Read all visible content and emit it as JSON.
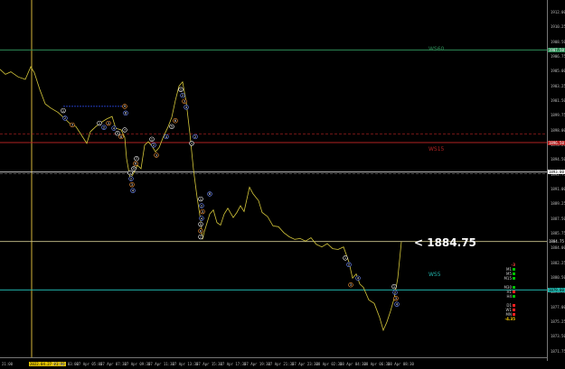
{
  "current_price_label": "< 1884.75",
  "levels": {
    "ws60": {
      "label": "WS60",
      "color": "#2e8b57",
      "price": 1907.5
    },
    "ws15": {
      "label": "WS15",
      "color": "#b22222",
      "price": 1896.5
    },
    "ws15_upper": {
      "price": 1897.5
    },
    "ws5": {
      "label": "WS5",
      "color": "#20b2aa",
      "price": 1879.0
    },
    "current": {
      "price": 1884.75
    },
    "white": {
      "price": 1893.0
    }
  },
  "price_ticks": [
    "1912.00",
    "1910.25",
    "1908.50",
    "1906.75",
    "1905.00",
    "1903.25",
    "1901.50",
    "1899.75",
    "1898.00",
    "1896.25",
    "1894.50",
    "1892.75",
    "1891.00",
    "1889.25",
    "1887.50",
    "1885.75",
    "1884.00",
    "1882.25",
    "1880.50",
    "1878.75",
    "1877.00",
    "1875.25",
    "1873.50",
    "1871.75"
  ],
  "axis_flags": [
    {
      "text": "1907.50",
      "bg": "#2e8b57",
      "fg": "#fff",
      "price": 1907.5
    },
    {
      "text": "1896.50",
      "bg": "#b22222",
      "fg": "#fff",
      "price": 1896.5
    },
    {
      "text": "1893.00",
      "bg": "#ffffff",
      "fg": "#000",
      "price": 1893.0
    },
    {
      "text": "1884.75",
      "bg": "#000",
      "fg": "#fff",
      "price": 1884.75
    },
    {
      "text": "1879.00",
      "bg": "#20b2aa",
      "fg": "#000",
      "price": 1879.0
    }
  ],
  "time_labels": [
    "27 Apr 03:00",
    "27 Apr 05:00",
    "27 Apr 07:30",
    "27 Apr 09:30",
    "27 Apr 11:30",
    "27 Apr 13:30",
    "27 Apr 15:30",
    "27 Apr 17:30",
    "27 Apr 19:30",
    "27 Apr 21:30",
    "27 Apr 23:30",
    "28 Apr 02:30",
    "28 Apr 04:30",
    "28 Apr 06:30",
    "28 Apr 08:30"
  ],
  "time_highlight": "2022.04.27 01:00",
  "left_time": "21:00",
  "timeframes": [
    {
      "label": "",
      "color": "#ff4040",
      "value": "-3"
    },
    {
      "label": "M1",
      "color": "#00c000"
    },
    {
      "label": "M5",
      "color": "#00c000"
    },
    {
      "label": "M15",
      "color": "#00c000"
    },
    {
      "label": "",
      "color": ""
    },
    {
      "label": "M30",
      "color": "#00c000"
    },
    {
      "label": "H1",
      "color": "#ff2020"
    },
    {
      "label": "H4",
      "color": "#00c000"
    },
    {
      "label": "",
      "color": ""
    },
    {
      "label": "D1",
      "color": "#ff2020"
    },
    {
      "label": "W1",
      "color": "#ff2020"
    },
    {
      "label": "MN",
      "color": "#ff2020"
    },
    {
      "label": "",
      "color": "#ffd000",
      "value": "-4.35"
    }
  ],
  "price_series": [
    [
      0,
      1905.2
    ],
    [
      6,
      1904.6
    ],
    [
      12,
      1904.9
    ],
    [
      20,
      1904.3
    ],
    [
      28,
      1904.0
    ],
    [
      34,
      1905.5
    ],
    [
      38,
      1904.8
    ],
    [
      44,
      1902.8
    ],
    [
      50,
      1901.1
    ],
    [
      56,
      1900.6
    ],
    [
      64,
      1900.1
    ],
    [
      70,
      1899.5
    ],
    [
      78,
      1898.7
    ],
    [
      84,
      1898.4
    ],
    [
      90,
      1897.4
    ],
    [
      96,
      1896.4
    ],
    [
      100,
      1897.8
    ],
    [
      106,
      1898.4
    ],
    [
      112,
      1898.9
    ],
    [
      118,
      1899.3
    ],
    [
      124,
      1899.6
    ],
    [
      128,
      1898.2
    ],
    [
      134,
      1898.0
    ],
    [
      138,
      1897.1
    ],
    [
      140,
      1894.6
    ],
    [
      144,
      1892.2
    ],
    [
      148,
      1892.9
    ],
    [
      152,
      1893.8
    ],
    [
      156,
      1893.4
    ],
    [
      160,
      1896.2
    ],
    [
      164,
      1896.6
    ],
    [
      168,
      1896.1
    ],
    [
      172,
      1895.4
    ],
    [
      176,
      1895.9
    ],
    [
      180,
      1897.0
    ],
    [
      186,
      1898.4
    ],
    [
      190,
      1899.5
    ],
    [
      194,
      1901.5
    ],
    [
      198,
      1903.2
    ],
    [
      202,
      1903.7
    ],
    [
      206,
      1901.3
    ],
    [
      210,
      1897.6
    ],
    [
      214,
      1893.3
    ],
    [
      218,
      1890.0
    ],
    [
      222,
      1887.2
    ],
    [
      224,
      1885.0
    ],
    [
      226,
      1885.9
    ],
    [
      232,
      1888.0
    ],
    [
      236,
      1888.5
    ],
    [
      240,
      1887.0
    ],
    [
      244,
      1886.7
    ],
    [
      248,
      1888.0
    ],
    [
      252,
      1888.7
    ],
    [
      258,
      1887.6
    ],
    [
      262,
      1888.2
    ],
    [
      266,
      1889.0
    ],
    [
      270,
      1888.3
    ],
    [
      276,
      1891.2
    ],
    [
      280,
      1890.4
    ],
    [
      286,
      1889.6
    ],
    [
      290,
      1888.2
    ],
    [
      296,
      1887.7
    ],
    [
      302,
      1886.6
    ],
    [
      308,
      1886.5
    ],
    [
      314,
      1885.8
    ],
    [
      320,
      1885.3
    ],
    [
      326,
      1885.0
    ],
    [
      332,
      1885.1
    ],
    [
      338,
      1884.8
    ],
    [
      344,
      1885.2
    ],
    [
      350,
      1884.4
    ],
    [
      356,
      1884.1
    ],
    [
      362,
      1884.5
    ],
    [
      368,
      1883.9
    ],
    [
      374,
      1883.8
    ],
    [
      380,
      1884.1
    ],
    [
      386,
      1882.3
    ],
    [
      390,
      1880.4
    ],
    [
      394,
      1880.9
    ],
    [
      398,
      1879.7
    ],
    [
      402,
      1879.3
    ],
    [
      408,
      1877.8
    ],
    [
      414,
      1877.4
    ],
    [
      420,
      1875.7
    ],
    [
      424,
      1874.2
    ],
    [
      428,
      1875.2
    ],
    [
      432,
      1876.5
    ],
    [
      436,
      1878.0
    ],
    [
      440,
      1880.4
    ],
    [
      444,
      1884.7
    ]
  ],
  "markers": [
    {
      "t": 70,
      "p": 1900.3,
      "n": "1"
    },
    {
      "t": 72,
      "p": 1899.4,
      "n": "2"
    },
    {
      "t": 80,
      "p": 1898.6,
      "n": "3"
    },
    {
      "t": 110,
      "p": 1898.8,
      "n": "1"
    },
    {
      "t": 115,
      "p": 1898.3,
      "n": "2"
    },
    {
      "t": 120,
      "p": 1898.8,
      "n": "3"
    },
    {
      "t": 126,
      "p": 1898.2,
      "n": "4"
    },
    {
      "t": 130,
      "p": 1897.6,
      "n": "5"
    },
    {
      "t": 134,
      "p": 1897.2,
      "n": "6"
    },
    {
      "t": 138,
      "p": 1898.0,
      "n": "7"
    },
    {
      "t": 139,
      "p": 1900.0,
      "n": "8"
    },
    {
      "t": 138,
      "p": 1900.8,
      "n": "9"
    },
    {
      "t": 144,
      "p": 1892.9,
      "n": "1"
    },
    {
      "t": 145,
      "p": 1892.2,
      "n": "2"
    },
    {
      "t": 146,
      "p": 1891.5,
      "n": "3"
    },
    {
      "t": 147,
      "p": 1890.8,
      "n": "4"
    },
    {
      "t": 148,
      "p": 1893.4,
      "n": "5"
    },
    {
      "t": 150,
      "p": 1894.0,
      "n": "6"
    },
    {
      "t": 151,
      "p": 1894.6,
      "n": "7"
    },
    {
      "t": 168,
      "p": 1896.9,
      "n": "1"
    },
    {
      "t": 170,
      "p": 1896.2,
      "n": "2"
    },
    {
      "t": 173,
      "p": 1895.0,
      "n": "3"
    },
    {
      "t": 184,
      "p": 1897.2,
      "n": "4"
    },
    {
      "t": 190,
      "p": 1898.4,
      "n": "5"
    },
    {
      "t": 194,
      "p": 1899.1,
      "n": "6"
    },
    {
      "t": 200,
      "p": 1902.8,
      "n": "1"
    },
    {
      "t": 202,
      "p": 1902.1,
      "n": "2"
    },
    {
      "t": 204,
      "p": 1901.4,
      "n": "3"
    },
    {
      "t": 206,
      "p": 1900.7,
      "n": "4"
    },
    {
      "t": 212,
      "p": 1896.4,
      "n": "1"
    },
    {
      "t": 216,
      "p": 1897.2,
      "n": "2"
    },
    {
      "t": 222,
      "p": 1889.8,
      "n": "1"
    },
    {
      "t": 223,
      "p": 1889.0,
      "n": "2"
    },
    {
      "t": 224,
      "p": 1888.3,
      "n": "3"
    },
    {
      "t": 223,
      "p": 1887.5,
      "n": "4"
    },
    {
      "t": 222,
      "p": 1886.8,
      "n": "5"
    },
    {
      "t": 222,
      "p": 1886.0,
      "n": "6"
    },
    {
      "t": 222,
      "p": 1885.3,
      "n": "7"
    },
    {
      "t": 232,
      "p": 1890.4,
      "n": "8"
    },
    {
      "t": 382,
      "p": 1882.8,
      "n": "1"
    },
    {
      "t": 386,
      "p": 1882.0,
      "n": "2"
    },
    {
      "t": 388,
      "p": 1879.6,
      "n": "3"
    },
    {
      "t": 396,
      "p": 1880.4,
      "n": "4"
    },
    {
      "t": 436,
      "p": 1879.4,
      "n": "1"
    },
    {
      "t": 437,
      "p": 1878.7,
      "n": "2"
    },
    {
      "t": 438,
      "p": 1878.0,
      "n": "3"
    },
    {
      "t": 439,
      "p": 1877.3,
      "n": "4"
    }
  ]
}
